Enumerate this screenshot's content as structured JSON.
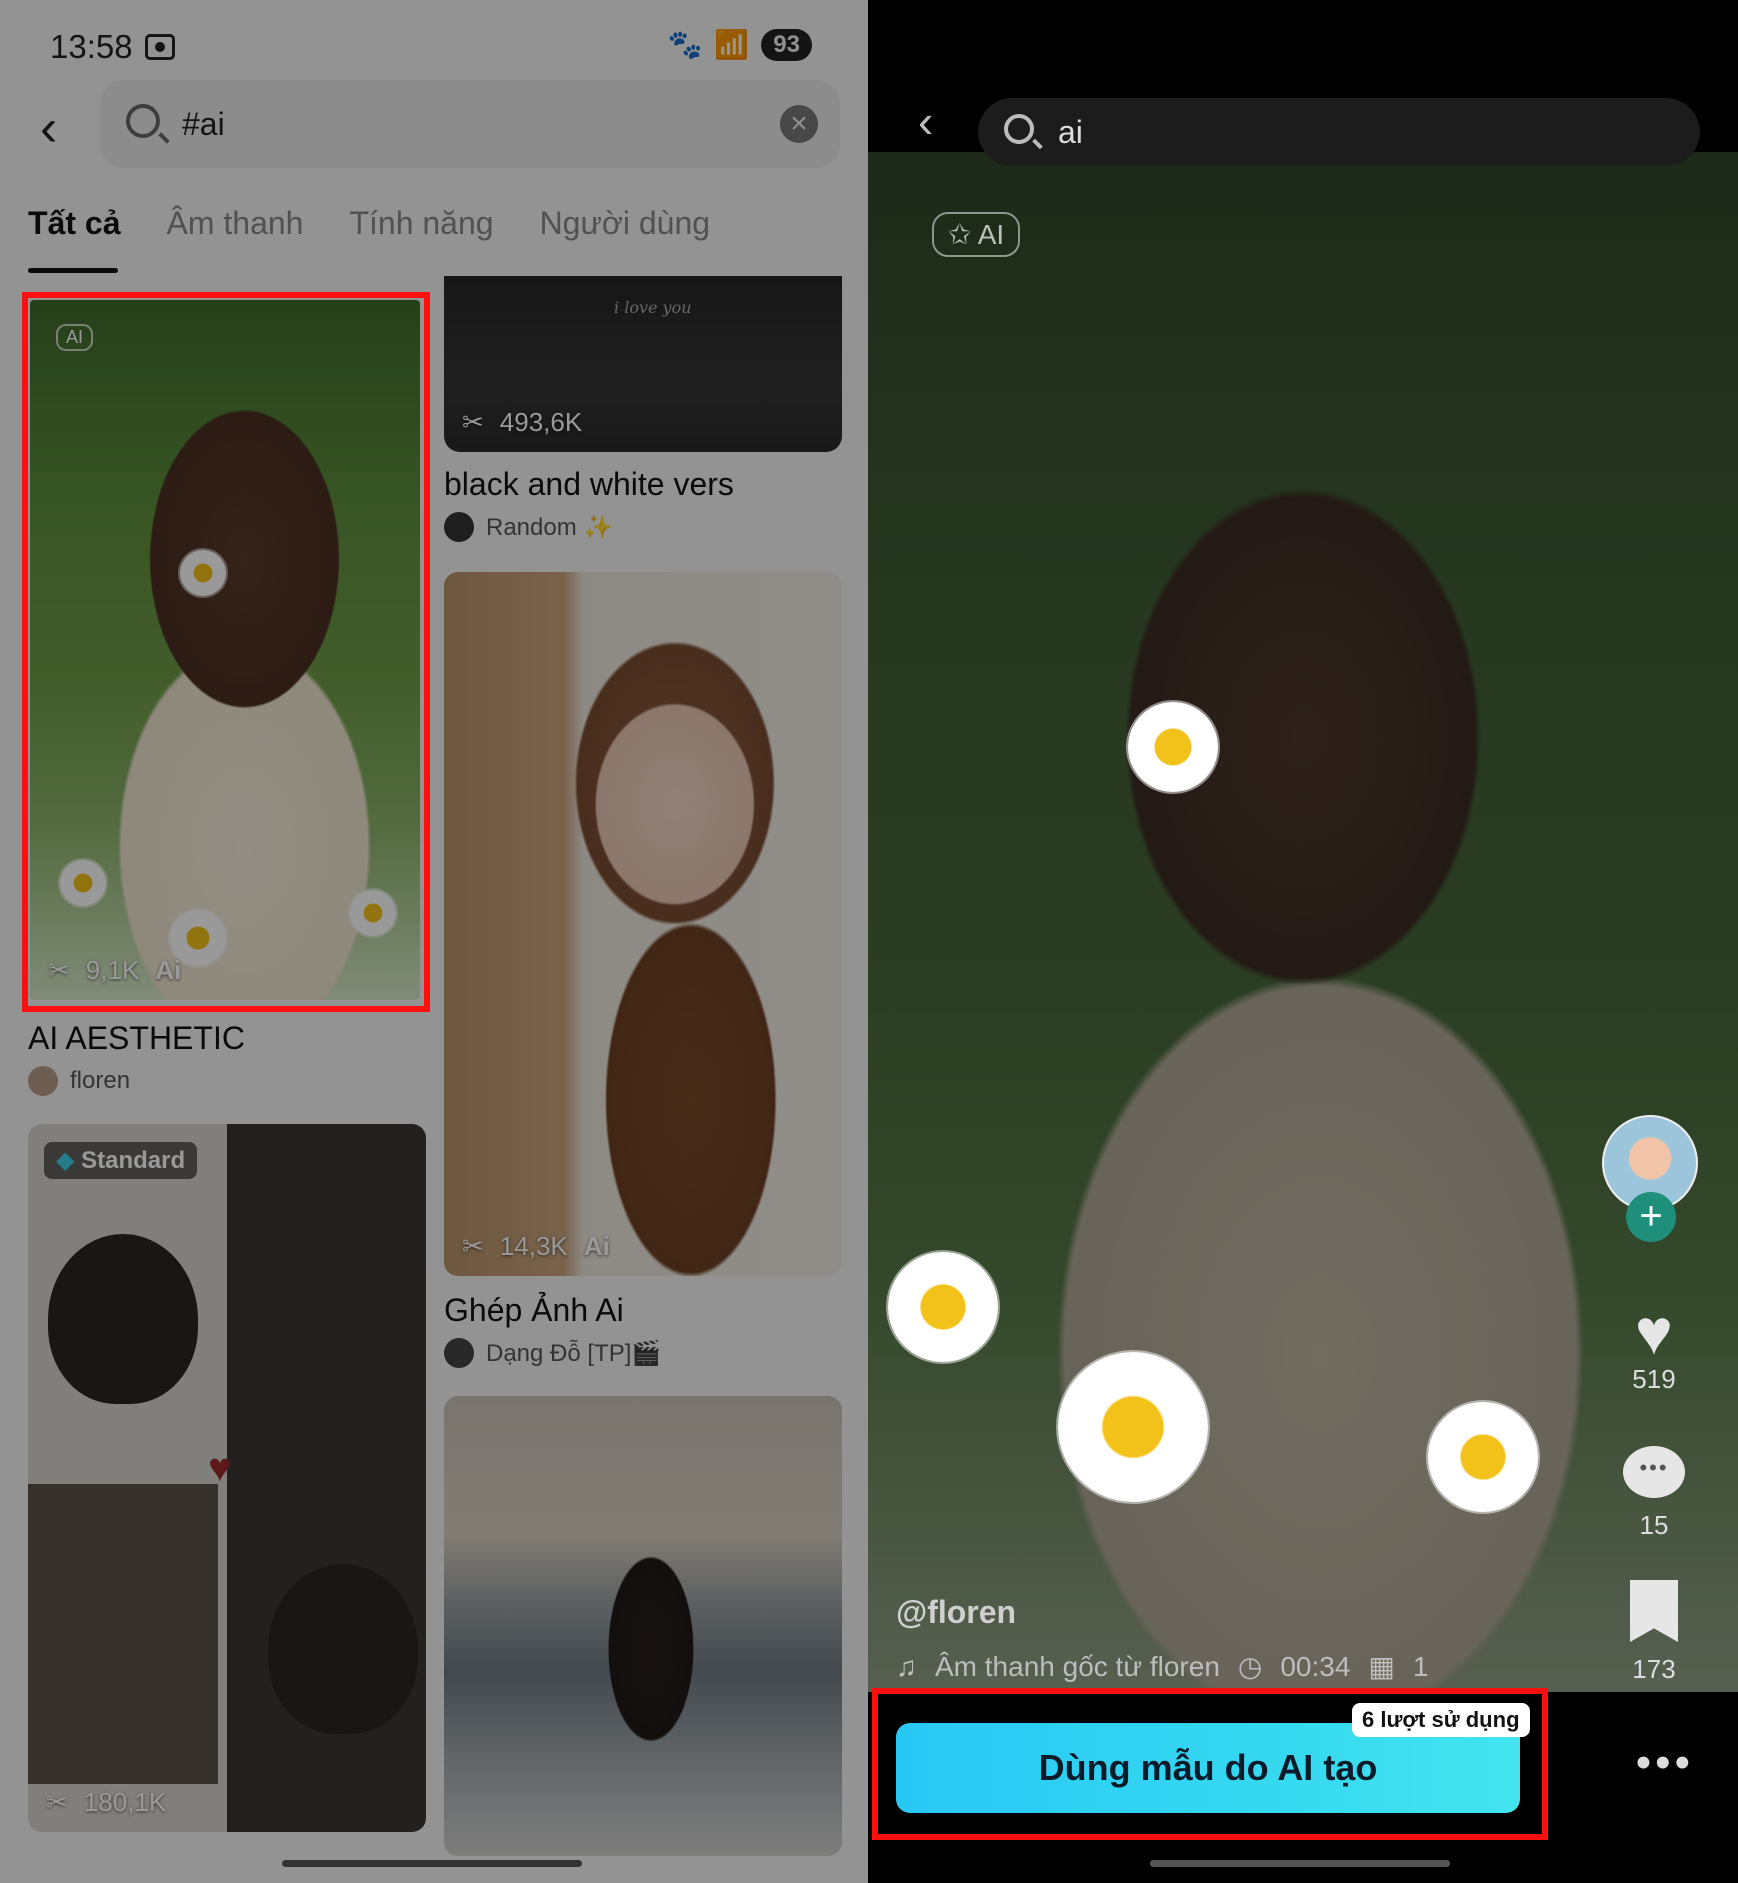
{
  "left": {
    "status": {
      "time": "13:58",
      "battery": "93"
    },
    "search": {
      "query": "#ai"
    },
    "tabs": [
      "Tất cả",
      "Âm thanh",
      "Tính năng",
      "Người dùng"
    ],
    "cards": [
      {
        "count": "9,1K",
        "tag": "Ai",
        "title": "AI AESTHETIC",
        "author": "floren",
        "badge": "AI"
      },
      {
        "count": "493,6K",
        "title": "black and white vers",
        "author": "Random ✨",
        "caption": "i love you"
      },
      {
        "count": "14,3K",
        "tag": "Ai",
        "title": "Ghép Ảnh Ai",
        "author": "Dạng Đỗ [TP]🎬"
      },
      {
        "count": "180,1K",
        "badge": "Standard"
      }
    ]
  },
  "right": {
    "search": {
      "query": "ai"
    },
    "ai_badge": "AI",
    "likes": "519",
    "comments": "15",
    "saves": "173",
    "username": "@floren",
    "sound": "Âm thanh gốc từ floren",
    "duration": "00:34",
    "clips": "1",
    "uses_badge": "6 lượt sử dụng",
    "cta": "Dùng mẫu do AI tạo"
  },
  "colors": {
    "highlight": "#ff1010",
    "cta": "#28c8f5"
  }
}
